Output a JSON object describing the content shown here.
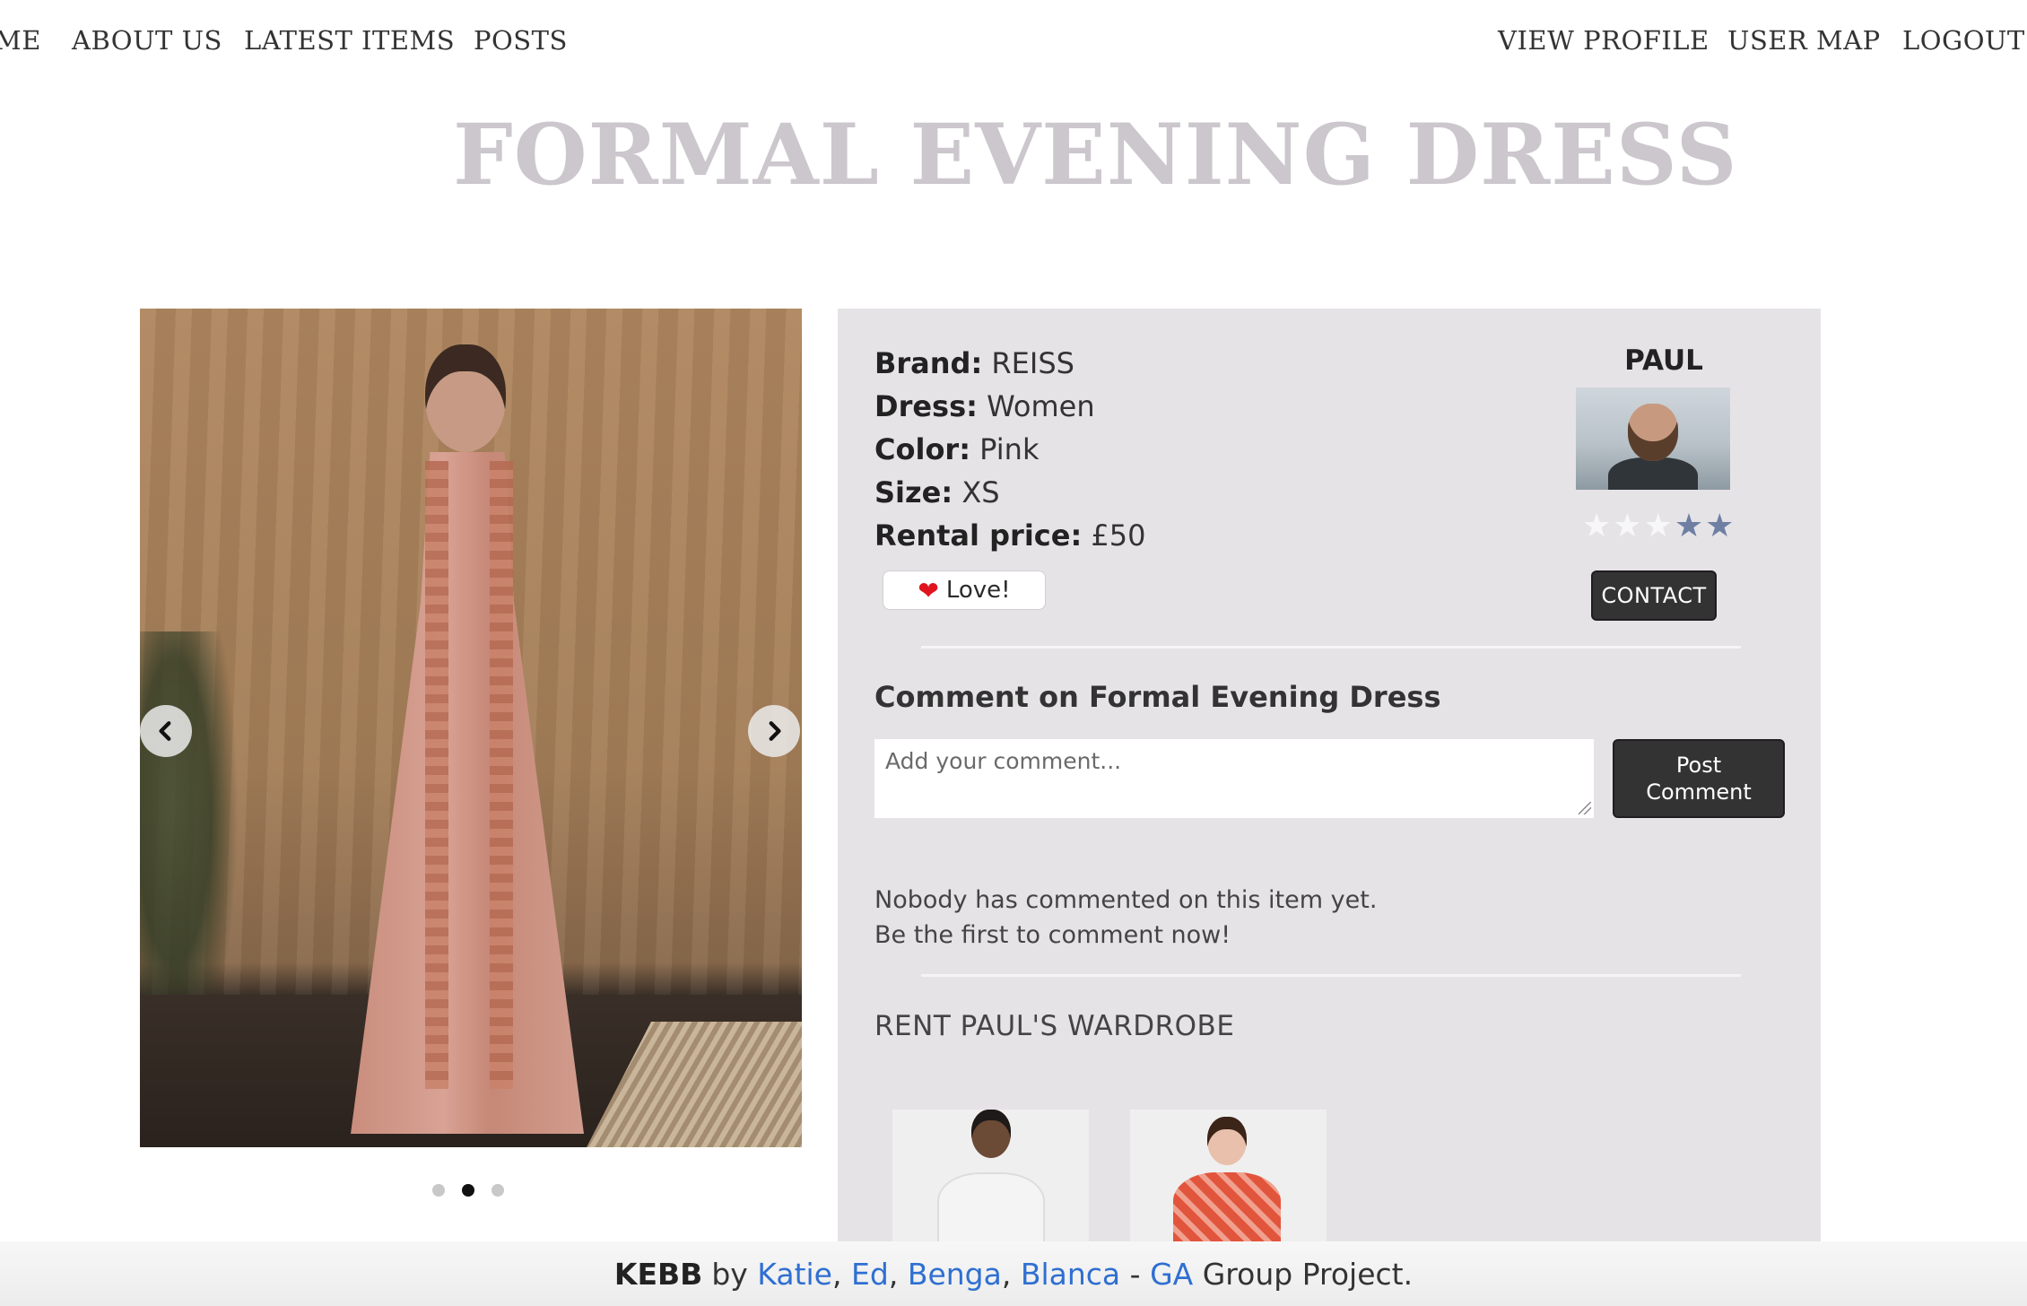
{
  "nav": {
    "left": [
      "ME",
      "ABOUT US",
      "LATEST ITEMS",
      "POSTS"
    ],
    "right": [
      "VIEW PROFILE",
      "USER MAP",
      "LOGOUT"
    ]
  },
  "page": {
    "title": "FORMAL EVENING DRESS"
  },
  "carousel": {
    "prev_icon": "chevron-left-icon",
    "next_icon": "chevron-right-icon",
    "slide_count": 3,
    "active_slide": 2
  },
  "details": {
    "brand_label": "Brand:",
    "brand": "REISS",
    "dress_label": "Dress:",
    "dress": "Women",
    "color_label": "Color:",
    "color": "Pink",
    "size_label": "Size:",
    "size": "XS",
    "price_label": "Rental price:",
    "price": "£50",
    "love_label": "Love!"
  },
  "owner": {
    "name": "PAUL",
    "rating": 3,
    "rating_max": 5,
    "contact_label": "CONTACT"
  },
  "comments": {
    "heading": "Comment on Formal Evening Dress",
    "placeholder": "Add your comment...",
    "post_label": "Post Comment",
    "empty_line1": "Nobody has commented on this item yet.",
    "empty_line2": "Be the first to comment now!"
  },
  "wardrobe": {
    "title": "RENT PAUL'S WARDROBE"
  },
  "footer": {
    "brand": "KEBB",
    "by": "by",
    "authors": [
      "Katie",
      "Ed",
      "Benga",
      "Blanca"
    ],
    "dash": "-",
    "org": "GA",
    "suffix": "Group Project."
  },
  "colors": {
    "title": "#cbc7cd",
    "panel_bg": "#e6e3e7",
    "button_dark": "#333333",
    "link": "#2f6fd1",
    "star_on": "#f7f7f9",
    "star_off": "#6f7fa3"
  }
}
